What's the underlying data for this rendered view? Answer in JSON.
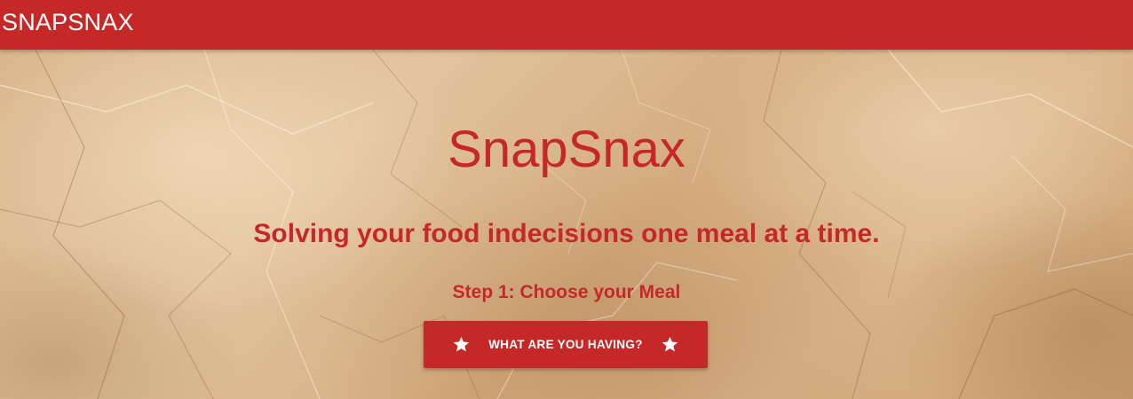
{
  "navbar": {
    "brand": "SNAPSNAX",
    "color": "#c62828"
  },
  "hero": {
    "title": "SnapSnax",
    "tagline": "Solving your food indecisions one meal at a time.",
    "step": "Step 1: Choose your Meal",
    "cta": {
      "label": "WHAT ARE YOU HAVING?",
      "icon_left": "star-icon",
      "icon_right": "star-icon"
    }
  }
}
